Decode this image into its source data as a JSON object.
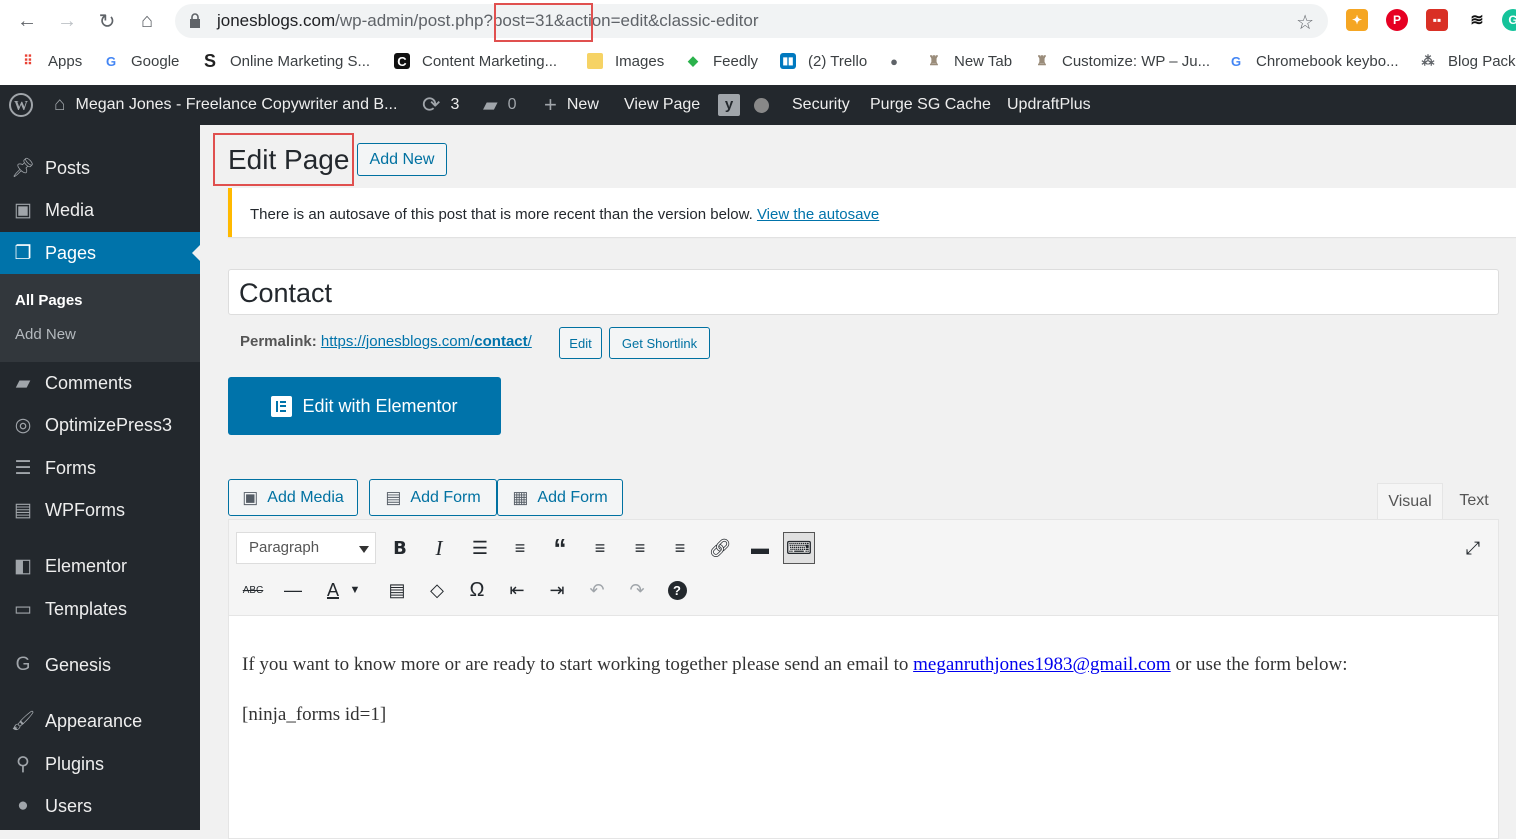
{
  "browser": {
    "url_domain": "jonesblogs.com",
    "url_path": "/wp-admin/post.php",
    "url_query": "?post=31&action=edit&classic-editor",
    "bookmarks": [
      {
        "label": "Apps"
      },
      {
        "label": "Google"
      },
      {
        "label": "Online Marketing S..."
      },
      {
        "label": "Content Marketing..."
      },
      {
        "label": "Images"
      },
      {
        "label": "Feedly"
      },
      {
        "label": "(2) Trello"
      },
      {
        "label": ""
      },
      {
        "label": "New Tab"
      },
      {
        "label": "Customize: WP – Ju..."
      },
      {
        "label": "Chromebook keybo..."
      },
      {
        "label": "Blog Packa"
      }
    ]
  },
  "adminbar": {
    "site_name": "Megan Jones - Freelance Copywriter and B...",
    "updates_count": "3",
    "comments_count": "0",
    "new_label": "New",
    "view_page": "View Page",
    "security": "Security",
    "purge": "Purge SG Cache",
    "updraft": "UpdraftPlus"
  },
  "sidebar": {
    "items": [
      {
        "label": "Posts",
        "icon": "pin-icon"
      },
      {
        "label": "Media",
        "icon": "media-icon"
      },
      {
        "label": "Pages",
        "icon": "pages-icon"
      },
      {
        "label": "Comments",
        "icon": "comment-icon"
      },
      {
        "label": "OptimizePress3",
        "icon": "optimizepress-icon"
      },
      {
        "label": "Forms",
        "icon": "forms-icon"
      },
      {
        "label": "WPForms",
        "icon": "wpforms-icon"
      },
      {
        "label": "Elementor",
        "icon": "elementor-icon"
      },
      {
        "label": "Templates",
        "icon": "folder-icon"
      },
      {
        "label": "Genesis",
        "icon": "genesis-icon"
      },
      {
        "label": "Appearance",
        "icon": "brush-icon"
      },
      {
        "label": "Plugins",
        "icon": "plug-icon"
      },
      {
        "label": "Users",
        "icon": "user-icon"
      }
    ],
    "submenu": {
      "all_pages": "All Pages",
      "add_new": "Add New"
    }
  },
  "page": {
    "title": "Edit Page",
    "add_new": "Add New",
    "notice_text": "There is an autosave of this post that is more recent than the version below.",
    "notice_link": "View the autosave",
    "post_title": "Contact",
    "permalink_label": "Permalink:",
    "permalink_base": "https://jonesblogs.com/",
    "permalink_slug": "contact",
    "permalink_end": "/",
    "edit_btn": "Edit",
    "shortlink_btn": "Get Shortlink",
    "elementor_btn": "Edit with Elementor",
    "add_media": "Add Media",
    "add_form_1": "Add Form",
    "add_form_2": "Add Form",
    "tab_visual": "Visual",
    "tab_text": "Text",
    "format_select": "Paragraph"
  },
  "content": {
    "para1_a": "If you want to know more or are ready to start working together please send an email to",
    "email": "meganruthjones1983@gmail.com",
    "para1_b": "or use the form below:",
    "shortcode": "[ninja_forms id=1]"
  },
  "colors": {
    "accent": "#0073aa",
    "adminbar": "#23282d",
    "notice": "#ffb900",
    "highlight": "#e0504f"
  }
}
